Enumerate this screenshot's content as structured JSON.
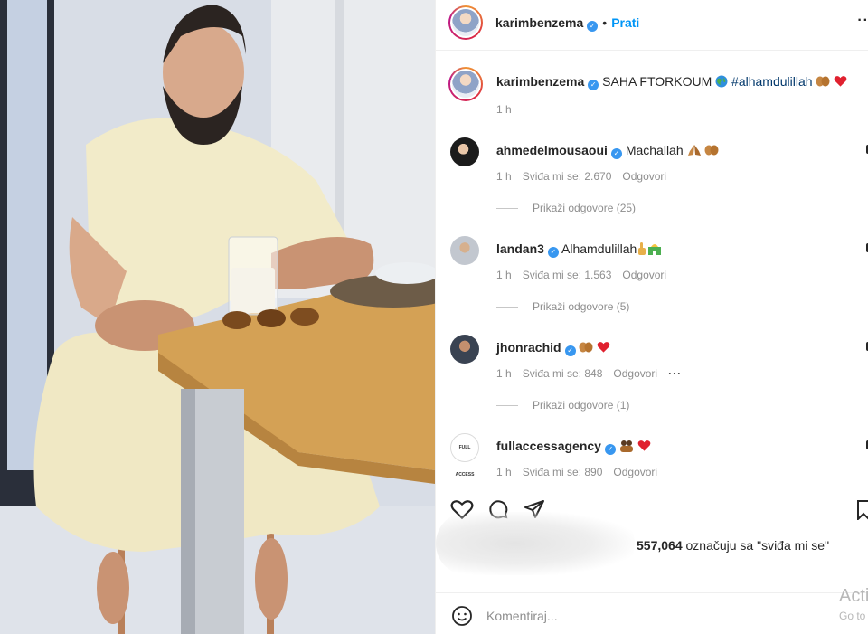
{
  "post": {
    "author": "karimbenzema",
    "follow_label": "Prati",
    "more_label": "···",
    "caption_text": "SAHA FTORKOUM",
    "caption_hashtag": "#alhamdulillah",
    "caption_time": "1 h"
  },
  "comments": [
    {
      "username": "ahmedelmousaoui",
      "text": "Machallah",
      "time": "1 h",
      "likes": "Sviđa mi se: 2.670",
      "reply": "Odgovori",
      "view_replies": "Prikaži odgovore (25)"
    },
    {
      "username": "landan3",
      "text": "Alhamdulillah",
      "time": "1 h",
      "likes": "Sviđa mi se: 1.563",
      "reply": "Odgovori",
      "view_replies": "Prikaži odgovore (5)"
    },
    {
      "username": "jhonrachid",
      "text": "",
      "time": "1 h",
      "likes": "Sviđa mi se: 848",
      "reply": "Odgovori",
      "more": "···",
      "view_replies": "Prikaži odgovore (1)"
    },
    {
      "username": "fullaccessagency",
      "text": "",
      "time": "1 h",
      "likes": "Sviđa mi se: 890",
      "reply": "Odgovori"
    }
  ],
  "likes": {
    "count": "557,064",
    "suffix": "označuju sa \"sviđa mi se\""
  },
  "add_comment": {
    "placeholder": "Komentiraj..."
  },
  "watermark": {
    "line1": "Acti",
    "line2": "Go to"
  },
  "colors": {
    "link_blue": "#0095f6",
    "verified_blue": "#3897f0",
    "heart_red": "#ed4956",
    "muted_gray": "#8e8e8e"
  }
}
